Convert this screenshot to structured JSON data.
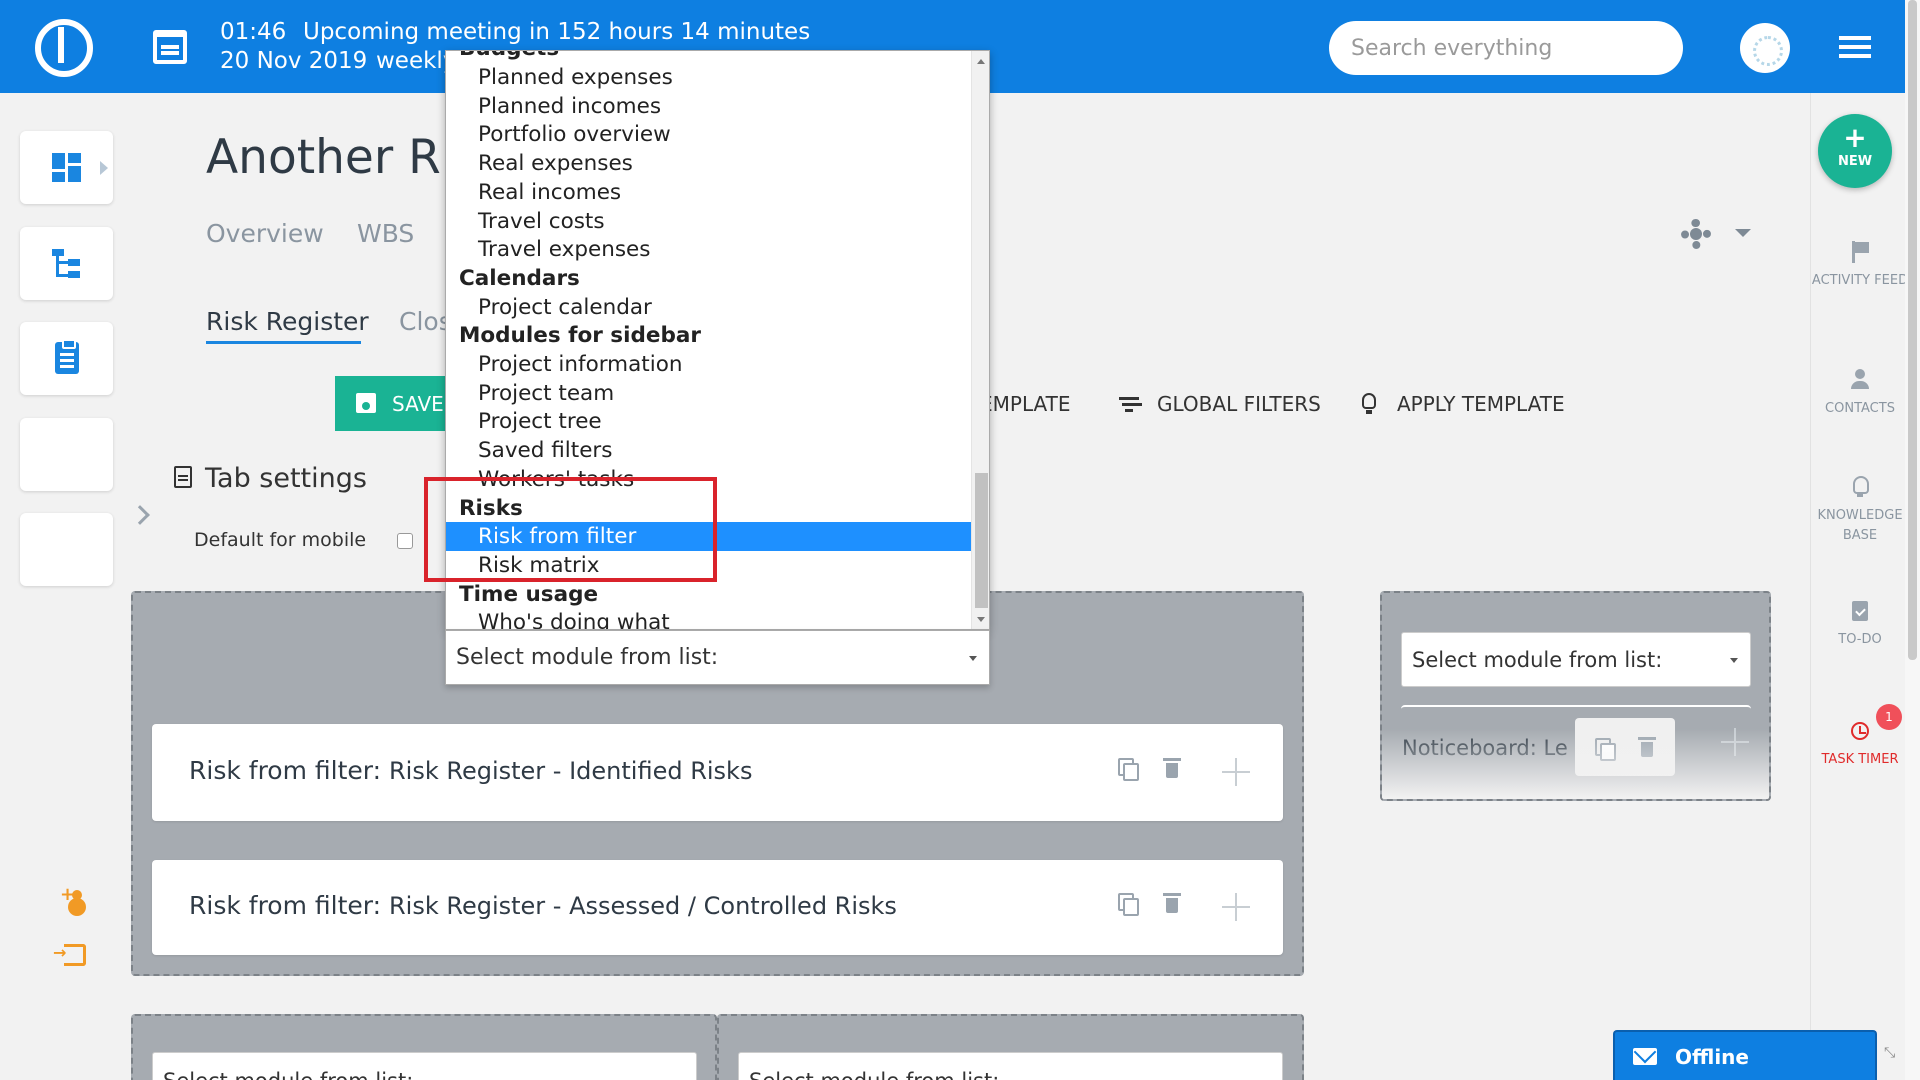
{
  "header": {
    "time": "01:46",
    "meeting_text": "Upcoming meeting in 152 hours 14 minutes",
    "date": "20 Nov 2019",
    "meeting_type": "weekly",
    "search_placeholder": "Search everything"
  },
  "page": {
    "title": "Another Ris",
    "tabs": [
      "Overview",
      "WBS"
    ],
    "subtabs": [
      "Risk Register",
      "Clos"
    ]
  },
  "toolbar": {
    "save_label": "SAVE",
    "template_label": "EMPLATE",
    "global_filters_label": "GLOBAL FILTERS",
    "apply_template_label": "APPLY TEMPLATE"
  },
  "tab_settings": {
    "title": "Tab settings",
    "default_for_mobile_label": "Default for mobile"
  },
  "dropdown": {
    "partial_top": "Budgets",
    "items": [
      {
        "label": "Planned expenses",
        "kind": "option"
      },
      {
        "label": "Planned incomes",
        "kind": "option"
      },
      {
        "label": "Portfolio overview",
        "kind": "option"
      },
      {
        "label": "Real expenses",
        "kind": "option"
      },
      {
        "label": "Real incomes",
        "kind": "option"
      },
      {
        "label": "Travel costs",
        "kind": "option"
      },
      {
        "label": "Travel expenses",
        "kind": "option"
      },
      {
        "label": "Calendars",
        "kind": "group"
      },
      {
        "label": "Project calendar",
        "kind": "option"
      },
      {
        "label": "Modules for sidebar",
        "kind": "group"
      },
      {
        "label": "Project information",
        "kind": "option"
      },
      {
        "label": "Project team",
        "kind": "option"
      },
      {
        "label": "Project tree",
        "kind": "option"
      },
      {
        "label": "Saved filters",
        "kind": "option"
      },
      {
        "label": "Workers' tasks",
        "kind": "option"
      },
      {
        "label": "Risks",
        "kind": "group"
      },
      {
        "label": "Risk from filter",
        "kind": "option",
        "selected": true
      },
      {
        "label": "Risk matrix",
        "kind": "option"
      },
      {
        "label": "Time usage",
        "kind": "group"
      },
      {
        "label": "Who's doing what",
        "kind": "option"
      }
    ],
    "select_label": "Select module from list:"
  },
  "modules": [
    {
      "prefix": "Risk from filter:",
      "name": "Risk Register - Identified Risks"
    },
    {
      "prefix": "Risk from filter:",
      "name": "Risk Register - Assessed / Controlled Risks"
    }
  ],
  "right_column": {
    "select_label": "Select module from list:",
    "noticeboard_label": "Noticeboard: Le"
  },
  "bottom_selects": [
    "Select module from list:",
    "Select module from list:"
  ],
  "sidebar_right": {
    "new_label": "NEW",
    "activity_feed": "ACTIVITY FEED",
    "contacts": "CONTACTS",
    "knowledge_base": "KNOWLEDGE BASE",
    "todo": "TO-DO",
    "task_timer": "TASK TIMER",
    "task_timer_badge": "1"
  },
  "chat": {
    "status": "Offline"
  },
  "colors": {
    "brand": "#0e7fe1",
    "accent": "#1ab394",
    "highlight": "#d9232b",
    "selected": "#1e90ff"
  }
}
